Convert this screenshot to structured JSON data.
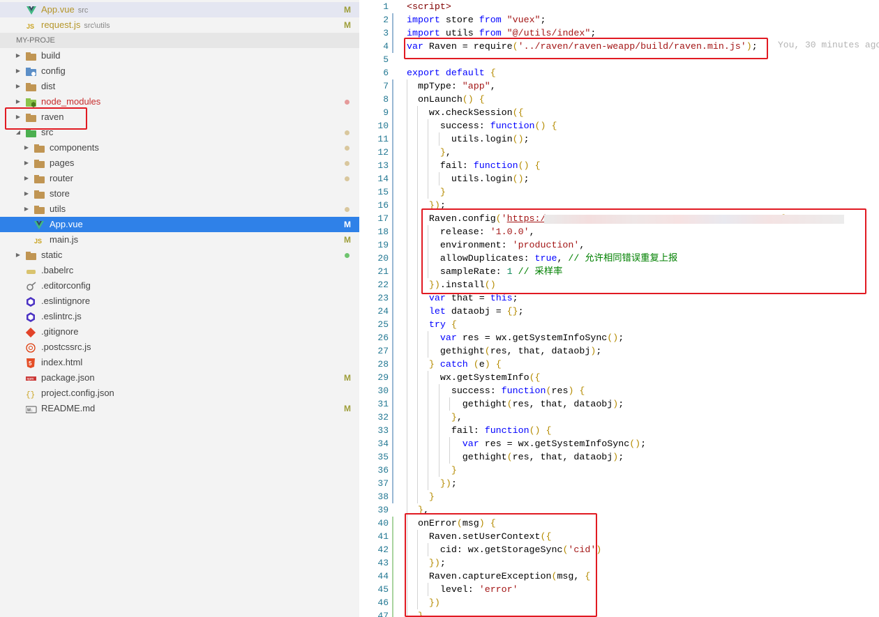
{
  "open_editors": [
    {
      "name": "App.vue",
      "folder": "src",
      "badge": "M",
      "icon": "vue-icon"
    },
    {
      "name": "request.js",
      "folder": "src\\utils",
      "badge": "M",
      "icon": "js-icon"
    }
  ],
  "explorer": {
    "title": "MY-PROJE",
    "items": [
      {
        "label": "build",
        "depth": 0,
        "chevron": "right",
        "icon": "folder-icon"
      },
      {
        "label": "config",
        "depth": 0,
        "chevron": "right",
        "icon": "config-folder-icon"
      },
      {
        "label": "dist",
        "depth": 0,
        "chevron": "right",
        "icon": "folder-icon"
      },
      {
        "label": "node_modules",
        "depth": 0,
        "chevron": "right",
        "icon": "node-folder-icon",
        "color": "#c72e2e",
        "dot": "#e59a9a"
      },
      {
        "label": "raven",
        "depth": 0,
        "chevron": "right",
        "icon": "folder-icon"
      },
      {
        "label": "src",
        "depth": 0,
        "chevron": "down",
        "icon": "src-folder-icon",
        "dot": "#d9c79d"
      },
      {
        "label": "components",
        "depth": 1,
        "chevron": "right",
        "icon": "folder-icon",
        "dot": "#d9c79d"
      },
      {
        "label": "pages",
        "depth": 1,
        "chevron": "right",
        "icon": "folder-icon",
        "dot": "#d9c79d"
      },
      {
        "label": "router",
        "depth": 1,
        "chevron": "right",
        "icon": "folder-icon",
        "dot": "#d9c79d"
      },
      {
        "label": "store",
        "depth": 1,
        "chevron": "right",
        "icon": "folder-icon"
      },
      {
        "label": "utils",
        "depth": 1,
        "chevron": "right",
        "icon": "folder-icon",
        "dot": "#d9c79d"
      },
      {
        "label": "App.vue",
        "depth": 1,
        "chevron": "",
        "icon": "vue-icon",
        "badge": "M",
        "active": true
      },
      {
        "label": "main.js",
        "depth": 1,
        "chevron": "",
        "icon": "js-icon",
        "badge": "M"
      },
      {
        "label": "static",
        "depth": 0,
        "chevron": "right",
        "icon": "folder-icon",
        "dot": "#6ec46e"
      },
      {
        "label": ".babelrc",
        "depth": 0,
        "chevron": "",
        "icon": "babel-icon"
      },
      {
        "label": ".editorconfig",
        "depth": 0,
        "chevron": "",
        "icon": "editorconfig-icon"
      },
      {
        "label": ".eslintignore",
        "depth": 0,
        "chevron": "",
        "icon": "eslint-icon"
      },
      {
        "label": ".eslintrc.js",
        "depth": 0,
        "chevron": "",
        "icon": "eslint-icon"
      },
      {
        "label": ".gitignore",
        "depth": 0,
        "chevron": "",
        "icon": "git-icon"
      },
      {
        "label": ".postcssrc.js",
        "depth": 0,
        "chevron": "",
        "icon": "postcss-icon"
      },
      {
        "label": "index.html",
        "depth": 0,
        "chevron": "",
        "icon": "html-icon"
      },
      {
        "label": "package.json",
        "depth": 0,
        "chevron": "",
        "icon": "npm-icon",
        "badge": "M"
      },
      {
        "label": "project.config.json",
        "depth": 0,
        "chevron": "",
        "icon": "json-icon"
      },
      {
        "label": "README.md",
        "depth": 0,
        "chevron": "",
        "icon": "markdown-icon",
        "badge": "M"
      }
    ]
  },
  "editor": {
    "blame": "You, 30 minutes ago",
    "lines": [
      {
        "n": "1",
        "indent": 0,
        "html": "<span class=\"t\">&lt;script&gt;</span>"
      },
      {
        "n": "2",
        "indent": 0,
        "html": "<span class=\"k\">import</span> store <span class=\"k\">from</span> <span class=\"s\">\"vuex\"</span>;"
      },
      {
        "n": "3",
        "indent": 0,
        "html": "<span class=\"k\">import</span> utils <span class=\"k\">from</span> <span class=\"s\">\"@/utils/index\"</span>;"
      },
      {
        "n": "4",
        "indent": 0,
        "html": "<span class=\"k\">var</span> Raven = require<span class=\"p\">(</span><span class=\"s\">'../raven/raven-weapp/build/raven.min.js'</span><span class=\"p\">)</span>;"
      },
      {
        "n": "5",
        "indent": 0,
        "html": ""
      },
      {
        "n": "6",
        "indent": 0,
        "html": "<span class=\"k\">export</span> <span class=\"k\">default</span> <span class=\"p\">{</span>"
      },
      {
        "n": "7",
        "indent": 1,
        "html": "  mpType: <span class=\"s\">\"app\"</span>,"
      },
      {
        "n": "8",
        "indent": 1,
        "html": "  onLaunch<span class=\"p\">()</span> <span class=\"p\">{</span>"
      },
      {
        "n": "9",
        "indent": 2,
        "html": "    wx.checkSession<span class=\"p\">({</span>"
      },
      {
        "n": "10",
        "indent": 3,
        "html": "      success: <span class=\"k\">function</span><span class=\"p\">()</span> <span class=\"p\">{</span>"
      },
      {
        "n": "11",
        "indent": 4,
        "html": "        utils.login<span class=\"p\">()</span>;"
      },
      {
        "n": "12",
        "indent": 3,
        "html": "      <span class=\"p\">}</span>,"
      },
      {
        "n": "13",
        "indent": 3,
        "html": "      fail: <span class=\"k\">function</span><span class=\"p\">()</span> <span class=\"p\">{</span>"
      },
      {
        "n": "14",
        "indent": 4,
        "html": "        utils.login<span class=\"p\">()</span>;"
      },
      {
        "n": "15",
        "indent": 3,
        "html": "      <span class=\"p\">}</span>"
      },
      {
        "n": "16",
        "indent": 2,
        "html": "    <span class=\"p\">})</span>;"
      },
      {
        "n": "17",
        "indent": 2,
        "html": "    Raven.config<span class=\"p\">(</span><span class=\"s\">'<u>https:/</u></span>                                          <span class=\"p\">{</span>"
      },
      {
        "n": "18",
        "indent": 3,
        "html": "      release: <span class=\"s\">'1.0.0'</span>,"
      },
      {
        "n": "19",
        "indent": 3,
        "html": "      environment: <span class=\"s\">'production'</span>,"
      },
      {
        "n": "20",
        "indent": 3,
        "html": "      allowDuplicates: <span class=\"k\">true</span>, <span class=\"c\">// 允许相同错误重复上报</span>"
      },
      {
        "n": "21",
        "indent": 3,
        "html": "      sampleRate: <span class=\"n\">1</span> <span class=\"c\">// 采样率</span>"
      },
      {
        "n": "22",
        "indent": 2,
        "html": "    <span class=\"p\">})</span>.install<span class=\"p\">()</span>"
      },
      {
        "n": "23",
        "indent": 2,
        "html": "    <span class=\"k\">var</span> that = <span class=\"k\">this</span>;"
      },
      {
        "n": "24",
        "indent": 2,
        "html": "    <span class=\"k\">let</span> dataobj = <span class=\"p\">{}</span>;"
      },
      {
        "n": "25",
        "indent": 2,
        "html": "    <span class=\"k\">try</span> <span class=\"p\">{</span>"
      },
      {
        "n": "26",
        "indent": 3,
        "html": "      <span class=\"k\">var</span> res = wx.getSystemInfoSync<span class=\"p\">()</span>;"
      },
      {
        "n": "27",
        "indent": 3,
        "html": "      gethight<span class=\"p\">(</span>res, that, dataobj<span class=\"p\">)</span>;"
      },
      {
        "n": "28",
        "indent": 2,
        "html": "    <span class=\"p\">}</span> <span class=\"k\">catch</span> <span class=\"p\">(</span>e<span class=\"p\">)</span> <span class=\"p\">{</span>"
      },
      {
        "n": "29",
        "indent": 3,
        "html": "      wx.getSystemInfo<span class=\"p\">({</span>"
      },
      {
        "n": "30",
        "indent": 4,
        "html": "        success: <span class=\"k\">function</span><span class=\"p\">(</span>res<span class=\"p\">)</span> <span class=\"p\">{</span>"
      },
      {
        "n": "31",
        "indent": 5,
        "html": "          gethight<span class=\"p\">(</span>res, that, dataobj<span class=\"p\">)</span>;"
      },
      {
        "n": "32",
        "indent": 4,
        "html": "        <span class=\"p\">}</span>,"
      },
      {
        "n": "33",
        "indent": 4,
        "html": "        fail: <span class=\"k\">function</span><span class=\"p\">()</span> <span class=\"p\">{</span>"
      },
      {
        "n": "34",
        "indent": 5,
        "html": "          <span class=\"k\">var</span> res = wx.getSystemInfoSync<span class=\"p\">()</span>;"
      },
      {
        "n": "35",
        "indent": 5,
        "html": "          gethight<span class=\"p\">(</span>res, that, dataobj<span class=\"p\">)</span>;"
      },
      {
        "n": "36",
        "indent": 4,
        "html": "        <span class=\"p\">}</span>"
      },
      {
        "n": "37",
        "indent": 3,
        "html": "      <span class=\"p\">})</span>;"
      },
      {
        "n": "38",
        "indent": 2,
        "html": "    <span class=\"p\">}</span>"
      },
      {
        "n": "39",
        "indent": 1,
        "html": "  <span class=\"p\">}</span>,"
      },
      {
        "n": "40",
        "indent": 1,
        "html": "  onError<span class=\"p\">(</span>msg<span class=\"p\">)</span> <span class=\"p\">{</span>"
      },
      {
        "n": "41",
        "indent": 2,
        "html": "    Raven.setUserContext<span class=\"p\">({</span>"
      },
      {
        "n": "42",
        "indent": 3,
        "html": "      cid: wx.getStorageSync<span class=\"p\">(</span><span class=\"s\">'cid'</span><span class=\"p\">)</span>"
      },
      {
        "n": "43",
        "indent": 2,
        "html": "    <span class=\"p\">})</span>;"
      },
      {
        "n": "44",
        "indent": 2,
        "html": "    Raven.captureException<span class=\"p\">(</span>msg, <span class=\"p\">{</span>"
      },
      {
        "n": "45",
        "indent": 3,
        "html": "      level: <span class=\"s\">'error'</span>"
      },
      {
        "n": "46",
        "indent": 2,
        "html": "    <span class=\"p\">})</span>"
      },
      {
        "n": "47",
        "indent": 1,
        "html": "  <span class=\"p\">}</span>"
      }
    ]
  }
}
